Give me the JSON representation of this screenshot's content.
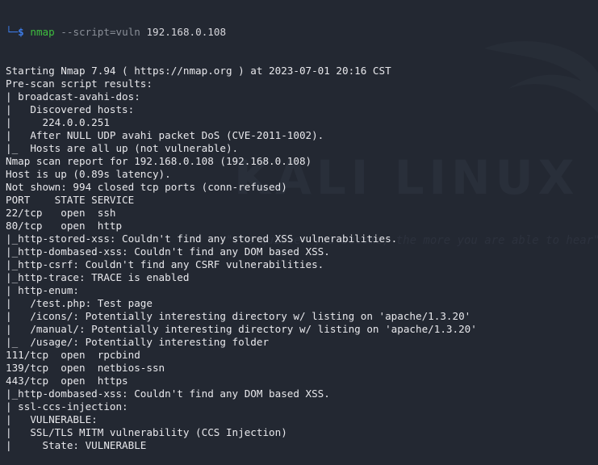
{
  "watermark": {
    "brand": "KALI LINUX",
    "tagline": "\"the quieter you become, the more you are able to hear\""
  },
  "prompt": {
    "corner": "└─",
    "dollar": "$",
    "command": "nmap",
    "flag": "--script=vuln",
    "target": "192.168.0.108"
  },
  "output": [
    "Starting Nmap 7.94 ( https://nmap.org ) at 2023-07-01 20:16 CST",
    "Pre-scan script results:",
    "| broadcast-avahi-dos:",
    "|   Discovered hosts:",
    "|     224.0.0.251",
    "|   After NULL UDP avahi packet DoS (CVE-2011-1002).",
    "|_  Hosts are all up (not vulnerable).",
    "Nmap scan report for 192.168.0.108 (192.168.0.108)",
    "Host is up (0.89s latency).",
    "Not shown: 994 closed tcp ports (conn-refused)",
    "PORT    STATE SERVICE",
    "22/tcp   open  ssh",
    "80/tcp   open  http",
    "|_http-stored-xss: Couldn't find any stored XSS vulnerabilities.",
    "|_http-dombased-xss: Couldn't find any DOM based XSS.",
    "|_http-csrf: Couldn't find any CSRF vulnerabilities.",
    "|_http-trace: TRACE is enabled",
    "| http-enum:",
    "|   /test.php: Test page",
    "|   /icons/: Potentially interesting directory w/ listing on 'apache/1.3.20'",
    "|   /manual/: Potentially interesting directory w/ listing on 'apache/1.3.20'",
    "|_  /usage/: Potentially interesting folder",
    "111/tcp  open  rpcbind",
    "139/tcp  open  netbios-ssn",
    "443/tcp  open  https",
    "|_http-dombased-xss: Couldn't find any DOM based XSS.",
    "| ssl-ccs-injection:",
    "|   VULNERABLE:",
    "|   SSL/TLS MITM vulnerability (CCS Injection)",
    "|     State: VULNERABLE"
  ],
  "colors": {
    "background": "#232832",
    "text": "#e8e8ec",
    "prompt": "#3d7be7",
    "command": "#3fbf3f",
    "flag": "#8a8f98",
    "watermark": "#2e3440"
  }
}
